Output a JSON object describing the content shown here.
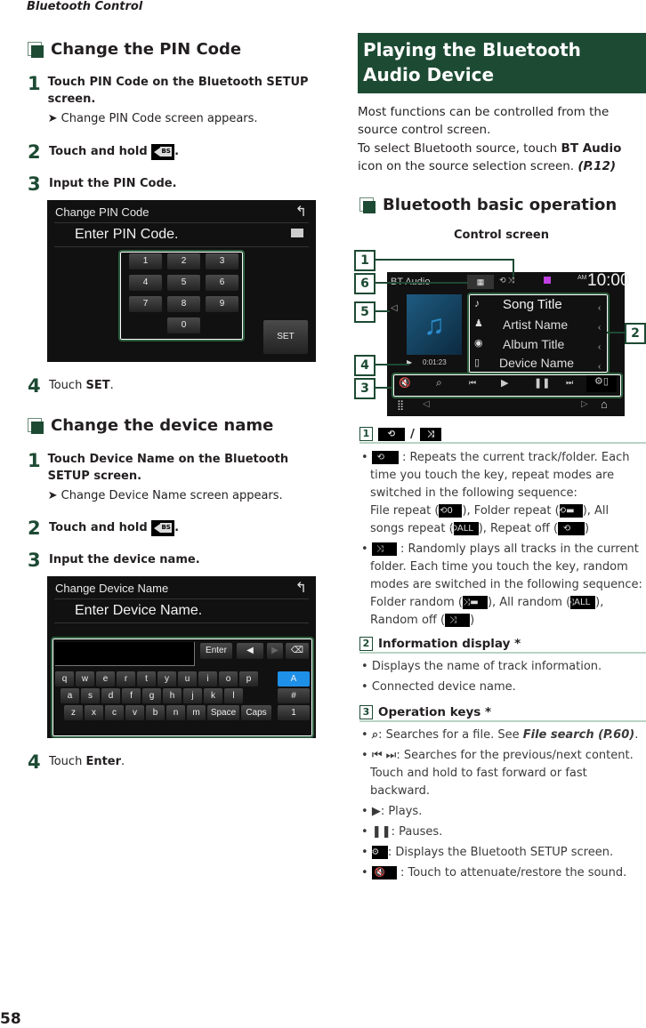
{
  "running_head": "Bluetooth Control",
  "page_number": "58",
  "left": {
    "pin_section": {
      "title": "Change the PIN Code",
      "steps": [
        {
          "num": "1",
          "pre": "Touch ",
          "key": "PIN Code",
          "post": " on the Bluetooth SETUP screen.",
          "note": "Change PIN Code screen appears."
        },
        {
          "num": "2",
          "text": "Touch and hold",
          "post": "."
        },
        {
          "num": "3",
          "text": "Input the PIN Code."
        },
        {
          "num": "4",
          "pre": "Touch ",
          "key": "SET",
          "post": "."
        }
      ],
      "screen": {
        "title": "Change PIN Code",
        "prompt": "Enter PIN Code.",
        "keys": [
          "1",
          "2",
          "3",
          "4",
          "5",
          "6",
          "7",
          "8",
          "9",
          "0"
        ],
        "set_label": "SET"
      }
    },
    "name_section": {
      "title": "Change the device name",
      "steps": [
        {
          "num": "1",
          "pre": "Touch ",
          "key": "Device Name",
          "post": " on the Bluetooth SETUP screen.",
          "note": "Change Device Name screen appears."
        },
        {
          "num": "2",
          "text": "Touch and hold",
          "post": "."
        },
        {
          "num": "3",
          "text": "Input the device name."
        },
        {
          "num": "4",
          "pre": "Touch ",
          "key": "Enter",
          "post": "."
        }
      ],
      "screen": {
        "title": "Change Device Name",
        "prompt": "Enter Device Name.",
        "enter_label": "Enter",
        "row1": [
          "q",
          "w",
          "e",
          "r",
          "t",
          "y",
          "u",
          "i",
          "o",
          "p"
        ],
        "row2": [
          "a",
          "s",
          "d",
          "f",
          "g",
          "h",
          "j",
          "k",
          "l"
        ],
        "row3": [
          "z",
          "x",
          "c",
          "v",
          "b",
          "n",
          "m"
        ],
        "space_label": "Space",
        "caps_label": "Caps",
        "modes": [
          "A",
          "#",
          "1"
        ],
        "active_mode_color": "#1e90e8"
      }
    }
  },
  "right": {
    "banner": "Playing the Bluetooth Audio Device",
    "intro1": "Most functions can be controlled from the source control screen.",
    "intro2_pre": "To select Bluetooth source, touch ",
    "intro2_key": "BT Audio",
    "intro2_post": " icon on the source selection screen. ",
    "intro2_ref": "(P.12)",
    "basic_title": "Bluetooth basic operation",
    "control_caption": "Control screen",
    "control_screen": {
      "source": "BT Audio",
      "time": "10:00",
      "ampm": "AM",
      "song": "Song Title",
      "artist": "Artist Name",
      "album": "Album Title",
      "device": "Device Name",
      "elapsed": "0:01:23",
      "callouts": [
        "1",
        "2",
        "3",
        "4",
        "5",
        "6"
      ]
    },
    "items": [
      {
        "num": "1",
        "sep": "/",
        "bullets": [
          {
            "pre": " : Repeats the current track/folder. Each time you touch the key, repeat modes are switched in the following sequence:",
            "line2": "File repeat (",
            "a": "), Folder repeat (",
            "b": "), All songs repeat (",
            "c": "), Repeat off (",
            "d": ")"
          },
          {
            "pre": " : Randomly plays all tracks in the current folder. Each time you touch the key, random modes are switched in the following sequence:",
            "line2": "Folder random (",
            "a": "), All random (",
            "b": "), Random off (",
            "c": ")"
          }
        ]
      },
      {
        "num": "2",
        "title": "Information display *",
        "bullets": [
          "Displays the name of track information.",
          "Connected device name."
        ]
      },
      {
        "num": "3",
        "title": "Operation keys *",
        "search_pre": ": Searches for a file. See ",
        "search_ref": "File search (P.60)",
        "search_post": ".",
        "skip": ": Searches for the previous/next content.",
        "skip2": "Touch and hold to fast forward or fast backward.",
        "play": ": Plays.",
        "pause": ": Pauses.",
        "setup": ": Displays the Bluetooth SETUP screen.",
        "mute": " : Touch to attenuate/restore the sound."
      }
    ]
  },
  "colors": {
    "accent": "#1d4a33",
    "rule": "#b9d3c3"
  }
}
